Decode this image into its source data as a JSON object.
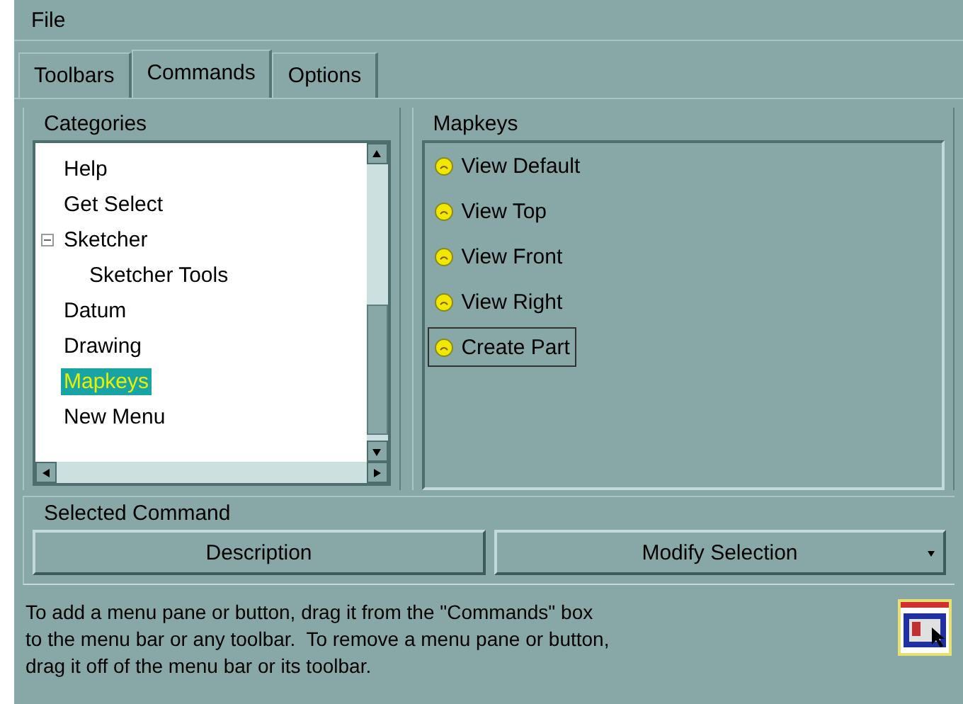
{
  "menu": [
    "File"
  ],
  "tabs": [
    {
      "label": "Toolbars",
      "selected": false
    },
    {
      "label": "Commands",
      "selected": true
    },
    {
      "label": "Options",
      "selected": false
    }
  ],
  "categories": {
    "title": "Categories",
    "items": [
      {
        "label": "Help",
        "selected": false
      },
      {
        "label": "Get Select",
        "selected": false
      },
      {
        "label": "Sketcher",
        "selected": false,
        "expanded": true,
        "children": [
          {
            "label": "Sketcher Tools",
            "selected": false
          }
        ]
      },
      {
        "label": "Datum",
        "selected": false
      },
      {
        "label": "Drawing",
        "selected": false
      },
      {
        "label": "Mapkeys",
        "selected": true
      },
      {
        "label": "New Menu",
        "selected": false
      }
    ]
  },
  "commands": {
    "title": "Mapkeys",
    "items": [
      {
        "label": "View Default",
        "selected": false
      },
      {
        "label": "View Top",
        "selected": false
      },
      {
        "label": "View Front",
        "selected": false
      },
      {
        "label": "View Right",
        "selected": false
      },
      {
        "label": "Create Part",
        "selected": true
      }
    ]
  },
  "selected_command": {
    "title": "Selected Command",
    "buttons": [
      "Description",
      "Modify Selection"
    ]
  },
  "help_text": [
    "To add a menu pane or button, drag it from the \"Commands\" box",
    "to the menu bar or any toolbar.  To remove a menu pane or button,",
    "drag it off of the menu bar or its toolbar."
  ]
}
